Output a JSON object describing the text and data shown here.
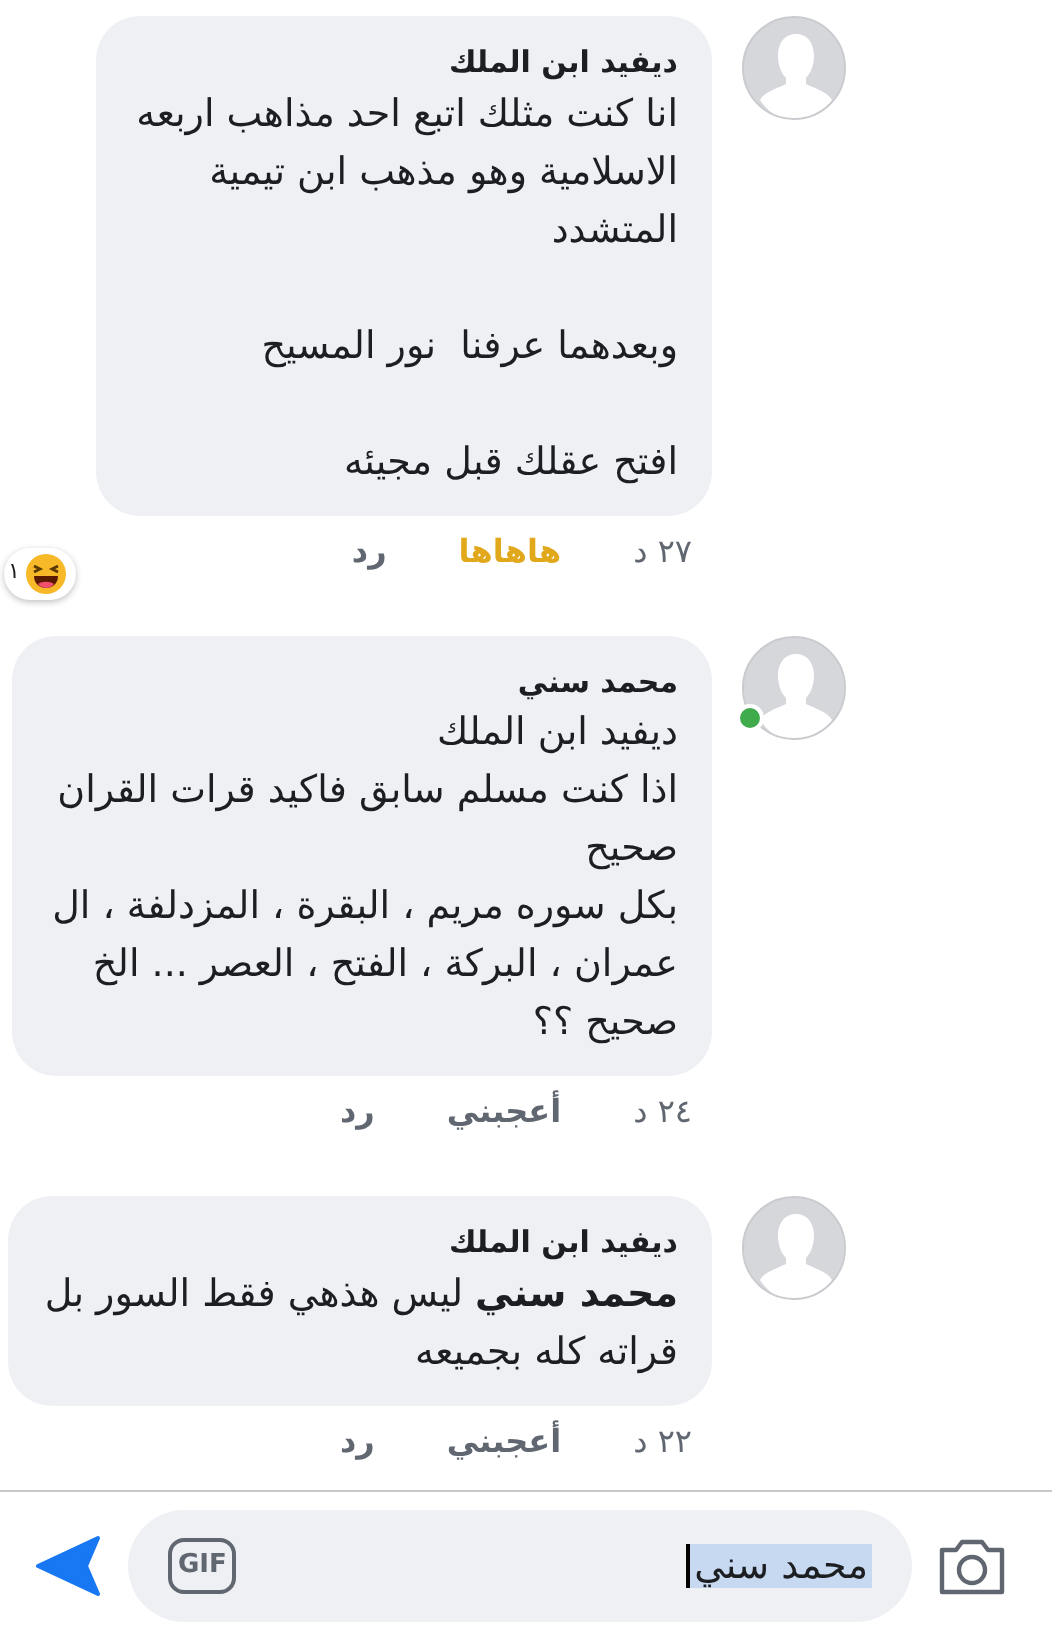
{
  "comments": [
    {
      "author": "ديفيد ابن الملك",
      "online": false,
      "text": "انا كنت مثلك اتبع احد مذاهب اربعه\nالاسلامية وهو مذهب ابن تيمية\nالمتشدد\n\nوبعدهما عرفنا  نور المسيح\n\nافتح عقلك قبل مجيئه",
      "time": "٢٧ د",
      "reaction_label": "هاهاها",
      "reacted": true,
      "reply": "رد",
      "reaction_count": "١"
    },
    {
      "author": "محمد سني",
      "online": true,
      "text": "ديفيد ابن الملك\nاذا كنت مسلم سابق فاكيد قرات القران\nصحيح\nبكل سوره مريم ، البقرة ، المزدلفة ، ال\nعمران ، البركة ، الفتح ، العصر ... الخ\nصحيح ؟؟",
      "time": "٢٤ د",
      "reaction_label": "أعجبني",
      "reacted": false,
      "reply": "رد"
    },
    {
      "author": "ديفيد ابن الملك",
      "online": false,
      "text": "**محمد سني** ليس هذهي فقط السور بل\nقراته كله بجميعه",
      "time": "٢٢ د",
      "reaction_label": "أعجبني",
      "reacted": false,
      "reply": "رد"
    }
  ],
  "composer": {
    "value": "محمد سني",
    "gif": "GIF"
  }
}
